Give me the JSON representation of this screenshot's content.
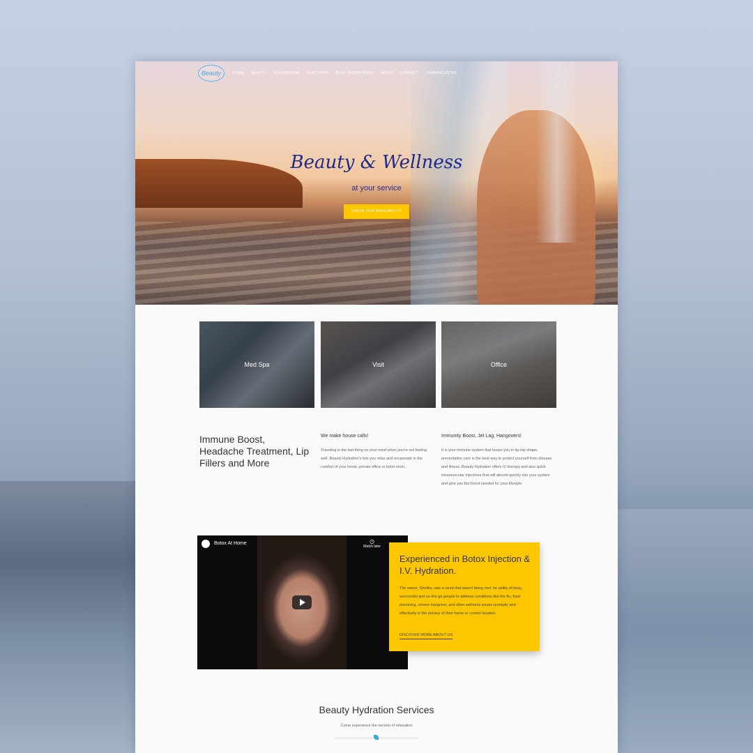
{
  "nav": {
    "logo_text": "Beauty",
    "items": [
      {
        "label": "HOME"
      },
      {
        "label": "BEAUTY"
      },
      {
        "label": "IV HYDRATION"
      },
      {
        "label": "INJECTIONS"
      },
      {
        "label": "BOOK APPOINTMENT"
      },
      {
        "label": "ABOUT"
      },
      {
        "label": "CONTACT"
      },
      {
        "label": "LOGIN/REGISTER"
      }
    ]
  },
  "hero": {
    "title": "Beauty & Wellness",
    "subtitle": "at your service",
    "button": "CHECK OUR AVAILABILITY"
  },
  "cards": [
    {
      "label": "Med Spa"
    },
    {
      "label": "Visit"
    },
    {
      "label": "Office"
    }
  ],
  "intro": {
    "title": "Immune Boost, Headache Treatment, Lip Fillers and More",
    "col1_head": "We make house calls!",
    "col1_text": "Traveling is the last thing on your mind when you're not feeling well. Beauty Hydration's lets you relax and recuperate in the comfort of your home, private office or hotel room.",
    "col2_head": "Immunity Boost, Jet Lag, Hangovers!",
    "col2_text": "It is your immune system that keeps you in tip-top shape, preventative care is the best way to protect yourself from disease and illness. Beauty Hydration offers IV therapy and also quick intramuscular injections that will absorb quickly into your system and give you the boost needed for your lifestyle."
  },
  "video": {
    "title": "Botox At Home",
    "watch_later": "Watch later"
  },
  "feature": {
    "title": "Experienced in Botox Injection & I.V. Hydration.",
    "text": "The owner, Shelley, saw a need that wasn't being met: he ability of busy, successful and on-the-go people to address conditions like the flu, food poisoning, severe hangover, and other wellness issues promptly and effectively in the privacy of their home or current location.",
    "link": "DISCOVER MORE ABOUT US"
  },
  "services": {
    "title": "Beauty Hydration Services",
    "subtitle": "Come experience the secrets of relaxation"
  }
}
